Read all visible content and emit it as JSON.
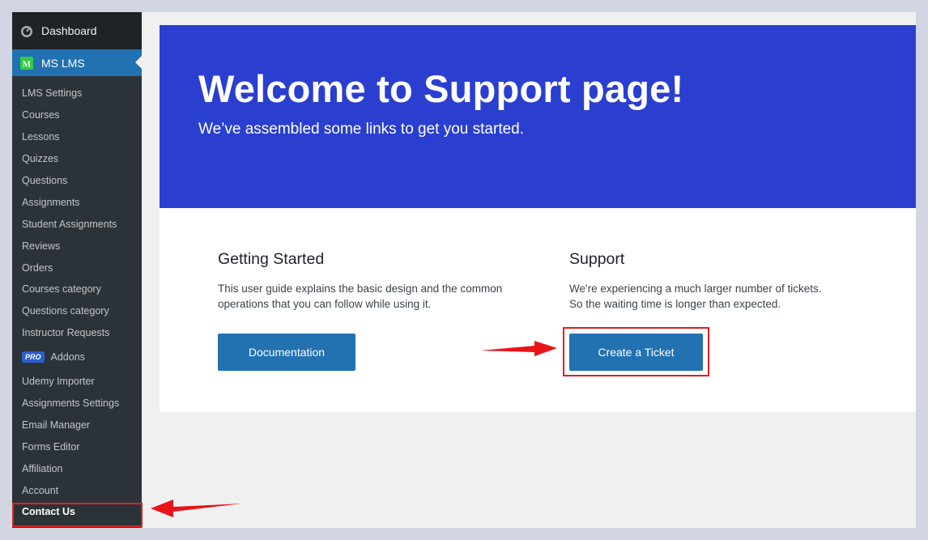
{
  "sidebar": {
    "dashboard_label": "Dashboard",
    "active_label": "MS LMS",
    "active_icon_letter": "M",
    "items": [
      {
        "label": "LMS Settings"
      },
      {
        "label": "Courses"
      },
      {
        "label": "Lessons"
      },
      {
        "label": "Quizzes"
      },
      {
        "label": "Questions"
      },
      {
        "label": "Assignments"
      },
      {
        "label": "Student Assignments"
      },
      {
        "label": "Reviews"
      },
      {
        "label": "Orders"
      },
      {
        "label": "Courses category"
      },
      {
        "label": "Questions category"
      },
      {
        "label": "Instructor Requests"
      },
      {
        "label": "Addons",
        "badge": "PRO"
      },
      {
        "label": "Udemy Importer"
      },
      {
        "label": "Assignments Settings"
      },
      {
        "label": "Email Manager"
      },
      {
        "label": "Forms Editor"
      },
      {
        "label": "Affiliation"
      },
      {
        "label": "Account"
      },
      {
        "label": "Contact Us"
      }
    ]
  },
  "hero": {
    "title": "Welcome to Support page!",
    "subtitle": "We’ve assembled some links to get you started."
  },
  "getting_started": {
    "heading": "Getting Started",
    "line1": "This user guide explains the basic design and the common",
    "line2": "operations that you can follow while using it.",
    "button": "Documentation"
  },
  "support": {
    "heading": "Support",
    "line1": "We're experiencing a much larger number of tickets.",
    "line2": "So the waiting time is longer than expected.",
    "button": "Create a Ticket"
  },
  "colors": {
    "hero_bg": "#2a3fd0",
    "button": "#2271b1",
    "highlight": "#e02020",
    "sidebar_active": "#2271b1"
  }
}
